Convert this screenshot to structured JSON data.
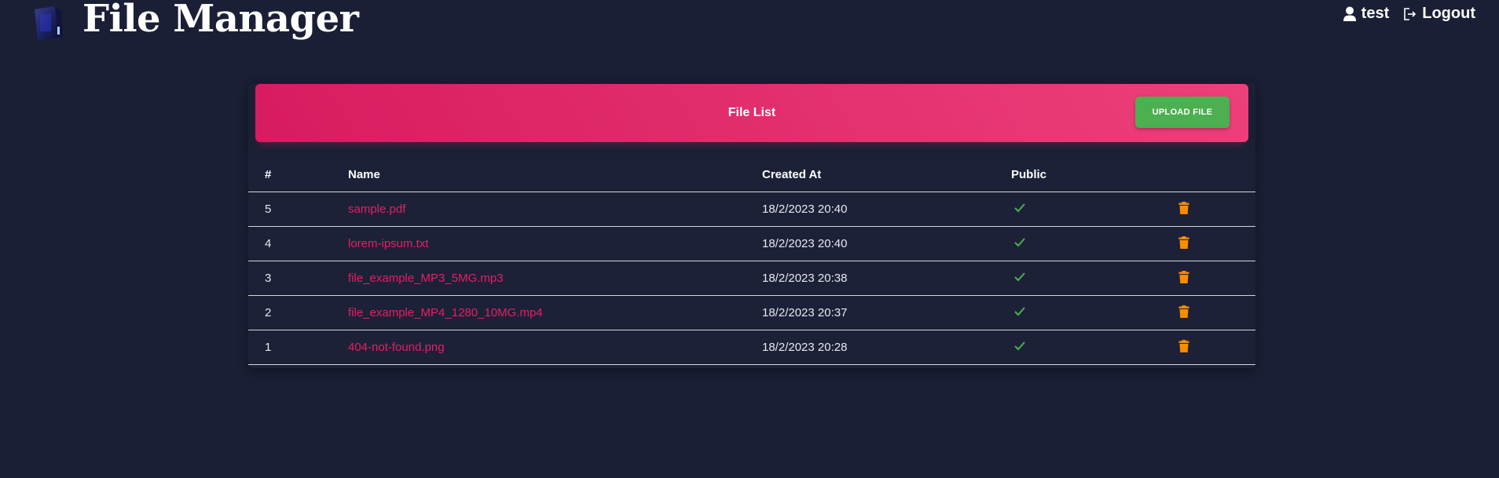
{
  "app": {
    "title": "File Manager"
  },
  "header": {
    "user_label": "test",
    "logout_label": "Logout"
  },
  "file_list": {
    "title": "File List",
    "upload_label": "UPLOAD FILE",
    "columns": [
      "#",
      "Name",
      "Created At",
      "Public"
    ],
    "rows": [
      {
        "id": "5",
        "name": "sample.pdf",
        "created_at": "18/2/2023 20:40",
        "public": true
      },
      {
        "id": "4",
        "name": "lorem-ipsum.txt",
        "created_at": "18/2/2023 20:40",
        "public": true
      },
      {
        "id": "3",
        "name": "file_example_MP3_5MG.mp3",
        "created_at": "18/2/2023 20:38",
        "public": true
      },
      {
        "id": "2",
        "name": "file_example_MP4_1280_10MG.mp4",
        "created_at": "18/2/2023 20:37",
        "public": true
      },
      {
        "id": "1",
        "name": "404-not-found.png",
        "created_at": "18/2/2023 20:28",
        "public": true
      }
    ]
  },
  "icons": {
    "logo": "file-manager-logo",
    "user": "user-icon",
    "logout": "logout-icon",
    "public": "check-icon",
    "delete": "trash-icon"
  },
  "colors": {
    "background": "#1a1f36",
    "accent": "#e91e63",
    "upload_button": "#4caf50",
    "check": "#4caf50",
    "delete": "#fb8c00"
  }
}
